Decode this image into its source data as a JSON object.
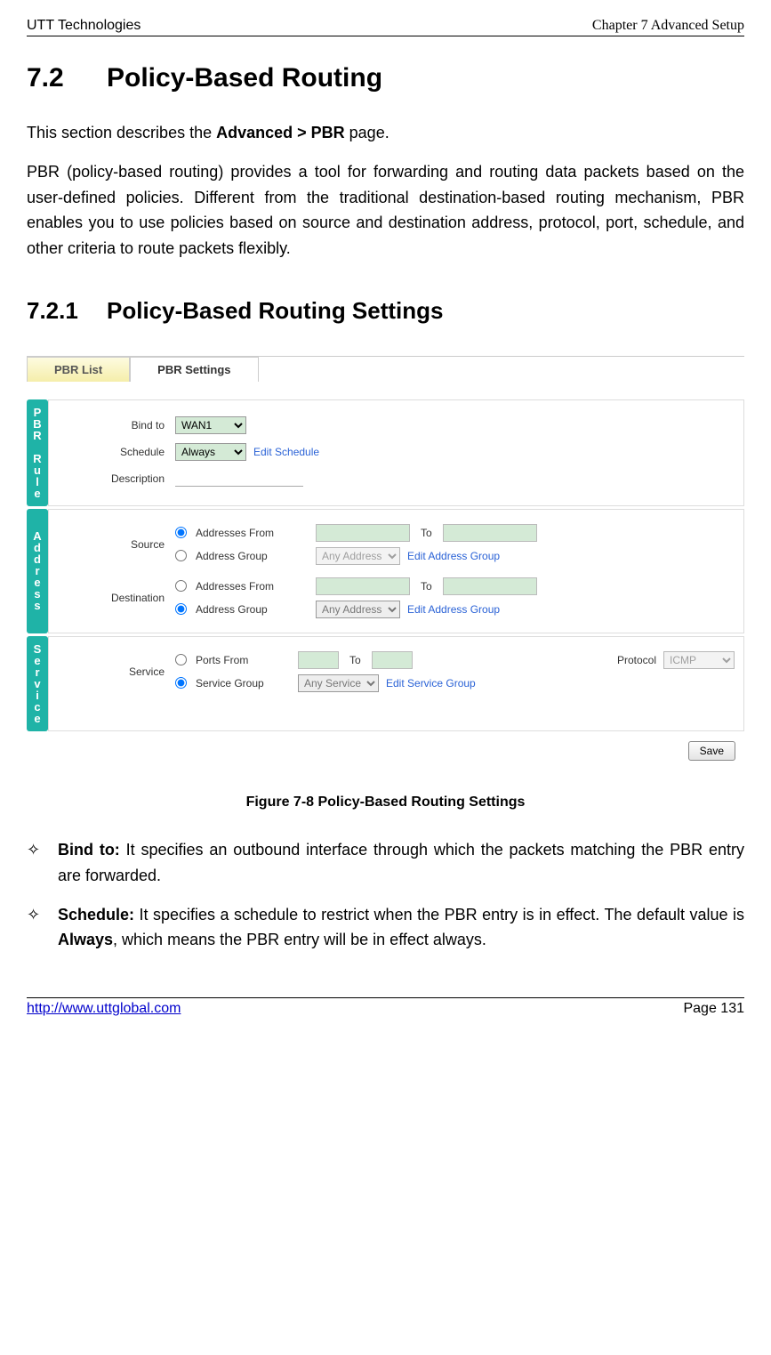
{
  "header": {
    "left": "UTT Technologies",
    "right_prefix": "Chapter 7 Advanced ",
    "right_suffix": "Setup"
  },
  "section": {
    "number": "7.2",
    "title": "Policy-Based Routing"
  },
  "intro_p1_a": "This section describes the ",
  "intro_p1_b": "Advanced > PBR",
  "intro_p1_c": " page.",
  "intro_p2": "PBR (policy-based routing) provides a tool for forwarding and routing data packets based on the user-defined policies. Different from the traditional destination-based routing mechanism, PBR enables you to use policies based on source and destination address, protocol, port, schedule, and other criteria to route packets flexibly.",
  "subsection": {
    "number": "7.2.1",
    "title": "Policy-Based Routing Settings"
  },
  "ui": {
    "tabs": {
      "list": "PBR List",
      "settings": "PBR Settings"
    },
    "sidelabels": {
      "rule": "PBR Rule",
      "address": "Address",
      "service": "Service"
    },
    "labels": {
      "bindto": "Bind to",
      "schedule": "Schedule",
      "description": "Description",
      "source": "Source",
      "destination": "Destination",
      "service": "Service",
      "addresses_from": "Addresses From",
      "address_group": "Address Group",
      "ports_from": "Ports From",
      "service_group": "Service Group",
      "to": "To",
      "protocol": "Protocol"
    },
    "values": {
      "bindto": "WAN1",
      "schedule": "Always",
      "address_group_sel": "Any Address",
      "service_group_sel": "Any Service",
      "protocol": "ICMP"
    },
    "links": {
      "edit_schedule": "Edit Schedule",
      "edit_address_group": "Edit Address Group",
      "edit_service_group": "Edit Service Group"
    },
    "save": "Save"
  },
  "figure_caption": "Figure 7-8 Policy-Based Routing Settings",
  "bullets": {
    "b1_label": "Bind to:",
    "b1_text": " It specifies an outbound interface through which the packets matching the PBR entry are forwarded.",
    "b2_label": "Schedule:",
    "b2_text_a": " It specifies a schedule to restrict when the PBR entry is in effect. The default value is ",
    "b2_text_b": "Always",
    "b2_text_c": ", which means the PBR entry will be in effect always."
  },
  "footer": {
    "url": "http://www.uttglobal.com",
    "page": "Page 131"
  }
}
